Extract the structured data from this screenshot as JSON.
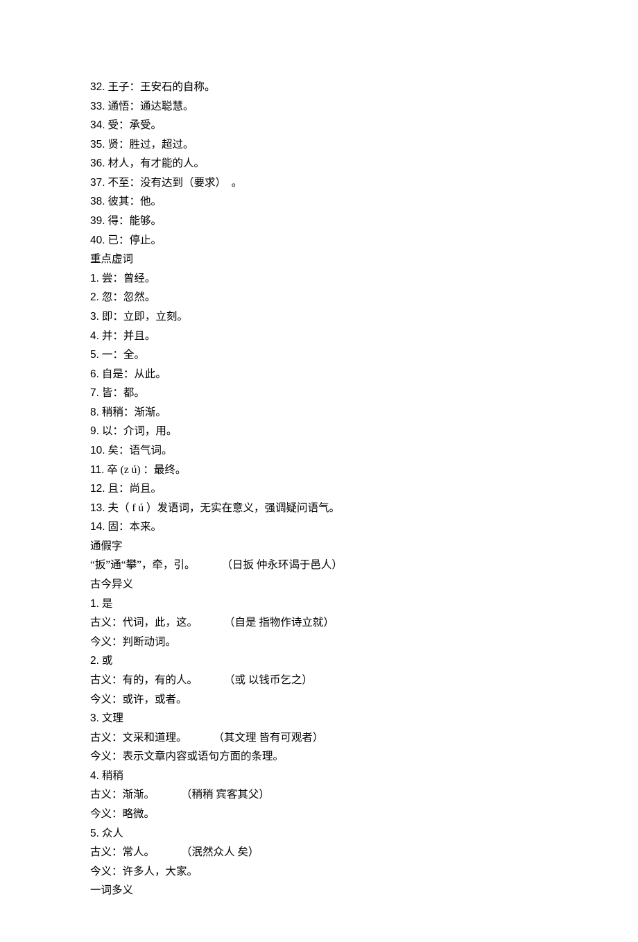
{
  "lines": [
    {
      "num": "32.",
      "t": "王子：王安石的自称。"
    },
    {
      "num": "33.",
      "t": "通悟：通达聪慧。"
    },
    {
      "num": "34.",
      "t": "受：承受。"
    },
    {
      "num": "35.",
      "t": "贤：胜过，超过。"
    },
    {
      "num": "36.",
      "t": "材人，有才能的人。"
    },
    {
      "num": "37.",
      "t": "不至：没有达到（要求）　。"
    },
    {
      "num": "38.",
      "t": "彼其：他。"
    },
    {
      "num": "39.",
      "t": "得：能够。"
    },
    {
      "num": "40.",
      "t": "已：停止。"
    }
  ],
  "hd1": "重点虚词",
  "xu": [
    {
      "num": "1.",
      "t": "尝：曾经。"
    },
    {
      "num": "2.",
      "t": "忽：忽然。"
    },
    {
      "num": "3.",
      "t": "即：立即，立刻。"
    },
    {
      "num": "4.",
      "t": "并：并且。"
    },
    {
      "num": "5.",
      "t": "一：全。"
    },
    {
      "num": "6.",
      "t": "自是：从此。"
    },
    {
      "num": "7.",
      "t": "皆：都。"
    },
    {
      "num": "8.",
      "t": "稍稍：渐渐。"
    },
    {
      "num": "9.",
      "t": "以：介词，用。"
    },
    {
      "num": "10.",
      "t": "矣：语气词。"
    },
    {
      "num": "11.",
      "t": "卒 (z ú) ：最终。"
    },
    {
      "num": "12.",
      "t": "且：尚且。"
    },
    {
      "num": "13.",
      "t": "夫（ f ú ）发语词，无实在意义，强调疑问语气。"
    },
    {
      "num": "14.",
      "t": "固：本来。"
    }
  ],
  "hd2": "通假字",
  "tongjia_a": "“扳”通“攀”，牵，引。",
  "tongjia_b": "（日扳 仲永环谒于邑人）",
  "hd3": "古今异义",
  "g1": {
    "num": "1.",
    "word": "是",
    "old_a": "古义：代词，此，这。",
    "old_b": "（自是 指物作诗立就）",
    "new": "今义：判断动词。"
  },
  "g2": {
    "num": "2.",
    "word": "或",
    "old_a": "古义：有的，有的人。",
    "old_b": "（或 以钱币乞之）",
    "new": "今义：或许，或者。"
  },
  "g3": {
    "num": "3.",
    "word": "文理",
    "old_a": "古义：文采和道理。",
    "old_b": "（其文理 皆有可观者）",
    "new": "今义：表示文章内容或语句方面的条理。"
  },
  "g4": {
    "num": "4.",
    "word": "稍稍",
    "old_a": "古义：渐渐。",
    "old_b": "（稍稍 宾客其父）",
    "new": "今义：略微。"
  },
  "g5": {
    "num": "5.",
    "word": "众人",
    "old_a": "古义：常人。",
    "old_b": "（泯然众人 矣）",
    "new": "今义：许多人，大家。"
  },
  "hd4": "一词多义"
}
